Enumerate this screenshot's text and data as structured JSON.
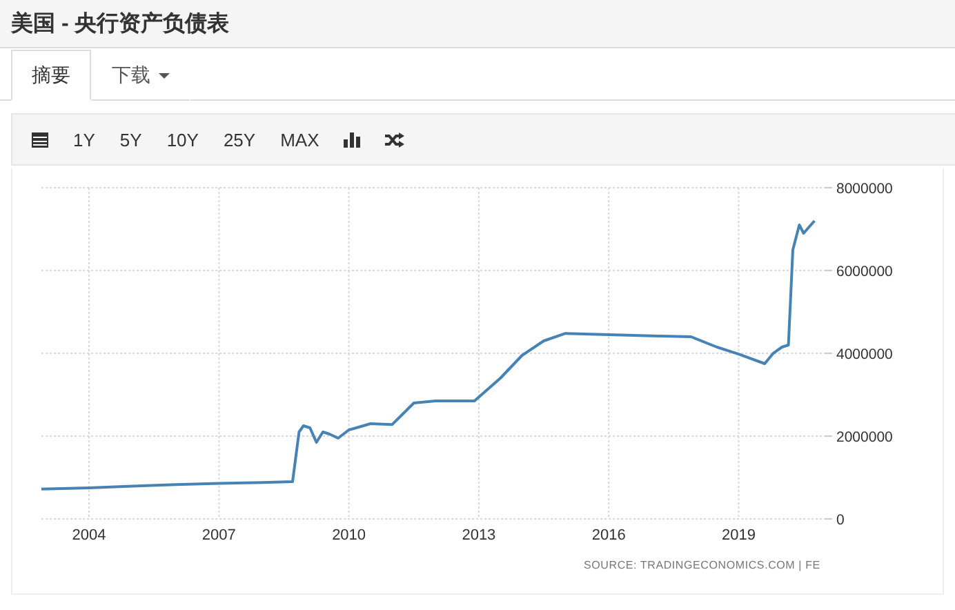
{
  "window": {
    "title": "美国 - 央行资产负债表"
  },
  "tabs": [
    {
      "label": "摘要",
      "selected": true,
      "kind": "plain"
    },
    {
      "label": "下载",
      "selected": false,
      "kind": "dropdown"
    }
  ],
  "toolbar": {
    "items": [
      {
        "kind": "calendar"
      },
      {
        "kind": "text",
        "label": "1Y"
      },
      {
        "kind": "text",
        "label": "5Y"
      },
      {
        "kind": "text",
        "label": "10Y"
      },
      {
        "kind": "text",
        "label": "25Y"
      },
      {
        "kind": "text",
        "label": "MAX"
      },
      {
        "kind": "bars"
      },
      {
        "kind": "shuffle"
      }
    ]
  },
  "chart": {
    "chart_data": {
      "type": "line",
      "xlim": [
        2002.9,
        2021
      ],
      "ylim": [
        0,
        8000000
      ],
      "xticks": [
        2004,
        2007,
        2010,
        2013,
        2016,
        2019
      ],
      "yticks": [
        {
          "value": 0,
          "label": "0"
        },
        {
          "value": 2000000,
          "label": "2000000"
        },
        {
          "value": 4000000,
          "label": "4000000"
        },
        {
          "value": 6000000,
          "label": "6000000"
        },
        {
          "value": 8000000,
          "label": "8000000"
        }
      ],
      "x": [
        2002.9,
        2004,
        2005,
        2006,
        2007,
        2008,
        2008.7,
        2008.85,
        2008.95,
        2009.1,
        2009.25,
        2009.4,
        2009.55,
        2009.75,
        2010,
        2010.5,
        2011,
        2011.5,
        2012,
        2012.5,
        2012.9,
        2013.5,
        2014,
        2014.5,
        2015,
        2016,
        2017,
        2017.9,
        2018.5,
        2019,
        2019.6,
        2019.8,
        2020,
        2020.15,
        2020.25,
        2020.4,
        2020.5,
        2020.75
      ],
      "grid": true,
      "series": [
        {
          "color": "#4682b4",
          "values": [
            720000,
            750000,
            790000,
            830000,
            860000,
            880000,
            900000,
            2100000,
            2250000,
            2200000,
            1850000,
            2100000,
            2050000,
            1950000,
            2150000,
            2300000,
            2280000,
            2800000,
            2850000,
            2850000,
            2850000,
            3400000,
            3950000,
            4300000,
            4480000,
            4450000,
            4420000,
            4400000,
            4150000,
            3980000,
            3750000,
            4000000,
            4150000,
            4200000,
            6500000,
            7100000,
            6900000,
            7200000
          ]
        }
      ]
    },
    "source": "SOURCE: TRADINGECONOMICS.COM | FE"
  }
}
